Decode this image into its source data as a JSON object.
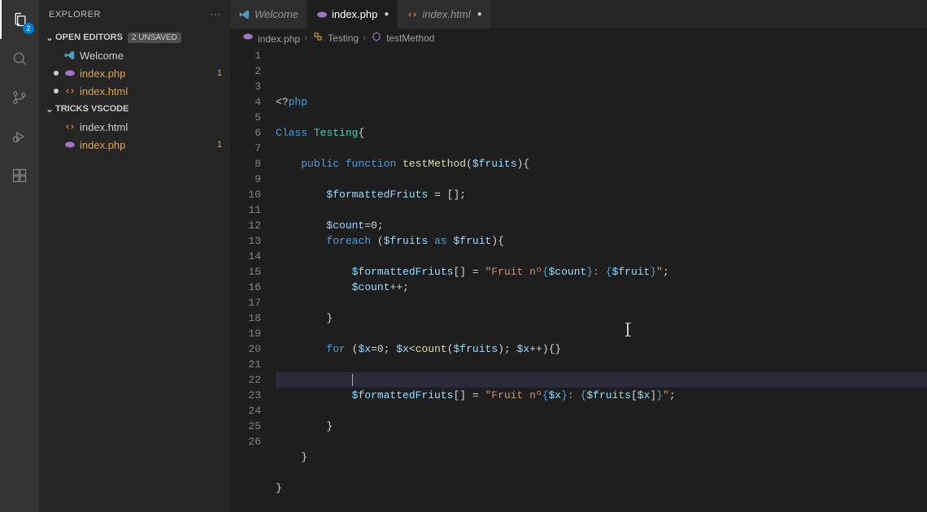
{
  "activityBar": {
    "badge": "2"
  },
  "sidebar": {
    "title": "EXPLORER",
    "more": "···",
    "sections": {
      "openEditors": {
        "label": "OPEN EDITORS",
        "unsaved": "2 UNSAVED",
        "items": [
          {
            "name": "Welcome",
            "icon": "vscode",
            "modified": false,
            "active": false
          },
          {
            "name": "index.php",
            "icon": "php",
            "modified": true,
            "active": false,
            "count": "1"
          },
          {
            "name": "index.html",
            "icon": "html",
            "modified": true,
            "active": false
          }
        ]
      },
      "folder": {
        "label": "TRICKS VSCODE",
        "items": [
          {
            "name": "index.html",
            "icon": "html",
            "modified": false
          },
          {
            "name": "index.php",
            "icon": "php",
            "modified": true,
            "count": "1"
          }
        ]
      }
    }
  },
  "tabs": [
    {
      "label": "Welcome",
      "icon": "vscode",
      "active": false,
      "modified": false
    },
    {
      "label": "index.php",
      "icon": "php",
      "active": true,
      "modified": true
    },
    {
      "label": "index.html",
      "icon": "html",
      "active": false,
      "modified": true
    }
  ],
  "breadcrumbs": {
    "parts": [
      {
        "icon": "php",
        "label": "index.php"
      },
      {
        "icon": "class",
        "label": "Testing"
      },
      {
        "icon": "method",
        "label": "testMethod"
      }
    ]
  },
  "gutter": {
    "start": 1,
    "end": 26
  },
  "code": {
    "lines": [
      [
        [
          "tk-op",
          "<?"
        ],
        [
          "tk-kw",
          "php"
        ]
      ],
      [],
      [
        [
          "tk-kw",
          "Class"
        ],
        [
          "",
          " "
        ],
        [
          "tk-cls",
          "Testing"
        ],
        [
          "tk-brace",
          "{"
        ]
      ],
      [],
      [
        [
          "",
          "    "
        ],
        [
          "tk-kw",
          "public"
        ],
        [
          "",
          " "
        ],
        [
          "tk-kw",
          "function"
        ],
        [
          "",
          " "
        ],
        [
          "tk-fn",
          "testMethod"
        ],
        [
          "tk-brace",
          "("
        ],
        [
          "tk-var",
          "$fruits"
        ],
        [
          "tk-brace",
          "){"
        ]
      ],
      [],
      [
        [
          "",
          "        "
        ],
        [
          "tk-var",
          "$formattedFriuts"
        ],
        [
          "",
          " = [];"
        ]
      ],
      [],
      [
        [
          "",
          "        "
        ],
        [
          "tk-var",
          "$count"
        ],
        [
          "",
          "="
        ],
        [
          "",
          "0"
        ],
        [
          "",
          ";"
        ]
      ],
      [
        [
          "",
          "        "
        ],
        [
          "tk-kw",
          "foreach"
        ],
        [
          "",
          " "
        ],
        [
          "tk-brace",
          "("
        ],
        [
          "tk-var",
          "$fruits"
        ],
        [
          "",
          " "
        ],
        [
          "tk-kw",
          "as"
        ],
        [
          "",
          " "
        ],
        [
          "tk-var",
          "$fruit"
        ],
        [
          "tk-brace",
          ")"
        ],
        [
          "tk-brace",
          "{"
        ]
      ],
      [],
      [
        [
          "",
          "            "
        ],
        [
          "tk-var",
          "$formattedFriuts"
        ],
        [
          "",
          "[] = "
        ],
        [
          "tk-str",
          "\"Fruit nº"
        ],
        [
          "tk-ph",
          "{"
        ],
        [
          "tk-var",
          "$count"
        ],
        [
          "tk-ph",
          "}"
        ],
        [
          "tk-str",
          ": "
        ],
        [
          "tk-ph",
          "{"
        ],
        [
          "tk-var",
          "$fruit"
        ],
        [
          "tk-ph",
          "}"
        ],
        [
          "tk-str",
          "\""
        ],
        [
          "",
          ";"
        ]
      ],
      [
        [
          "",
          "            "
        ],
        [
          "tk-var",
          "$count"
        ],
        [
          "",
          "++;"
        ]
      ],
      [],
      [
        [
          "",
          "        "
        ],
        [
          "tk-brace",
          "}"
        ]
      ],
      [],
      [
        [
          "",
          "        "
        ],
        [
          "tk-kw",
          "for"
        ],
        [
          "",
          " "
        ],
        [
          "tk-brace",
          "("
        ],
        [
          "tk-var",
          "$x"
        ],
        [
          "",
          "="
        ],
        [
          "",
          "0"
        ],
        [
          "",
          "; "
        ],
        [
          "tk-var",
          "$x"
        ],
        [
          "",
          "<"
        ],
        [
          "tk-fn",
          "count"
        ],
        [
          "tk-brace",
          "("
        ],
        [
          "tk-var",
          "$fruits"
        ],
        [
          "tk-brace",
          ")"
        ],
        [
          "",
          "; "
        ],
        [
          "tk-var",
          "$x"
        ],
        [
          "",
          "++"
        ],
        [
          "tk-brace",
          ")"
        ],
        [
          "tk-brace",
          "{}"
        ]
      ],
      [],
      [
        [
          "",
          "            "
        ]
      ],
      [
        [
          "",
          "            "
        ],
        [
          "tk-var",
          "$formattedFriuts"
        ],
        [
          "",
          "[] = "
        ],
        [
          "tk-str",
          "\"Fruit nº"
        ],
        [
          "tk-ph",
          "{"
        ],
        [
          "tk-var",
          "$x"
        ],
        [
          "tk-ph",
          "}"
        ],
        [
          "tk-str",
          ": "
        ],
        [
          "tk-ph",
          "{"
        ],
        [
          "tk-var",
          "$fruits"
        ],
        [
          "",
          "["
        ],
        [
          "tk-var",
          "$x"
        ],
        [
          "",
          "]"
        ],
        [
          "tk-ph",
          "}"
        ],
        [
          "tk-str",
          "\""
        ],
        [
          "",
          ";"
        ]
      ],
      [],
      [
        [
          "",
          "        "
        ],
        [
          "tk-brace",
          "}"
        ]
      ],
      [],
      [
        [
          "",
          "    "
        ],
        [
          "tk-brace",
          "}"
        ]
      ],
      [],
      [
        [
          "tk-brace",
          "}"
        ]
      ]
    ],
    "highlightLine": 19,
    "cursorAtLine": 19
  },
  "colors": {
    "php": "#a074c4",
    "html": "#e37933",
    "vscode": "#519aba",
    "class": "#e8ab53",
    "method": "#b180d7"
  }
}
